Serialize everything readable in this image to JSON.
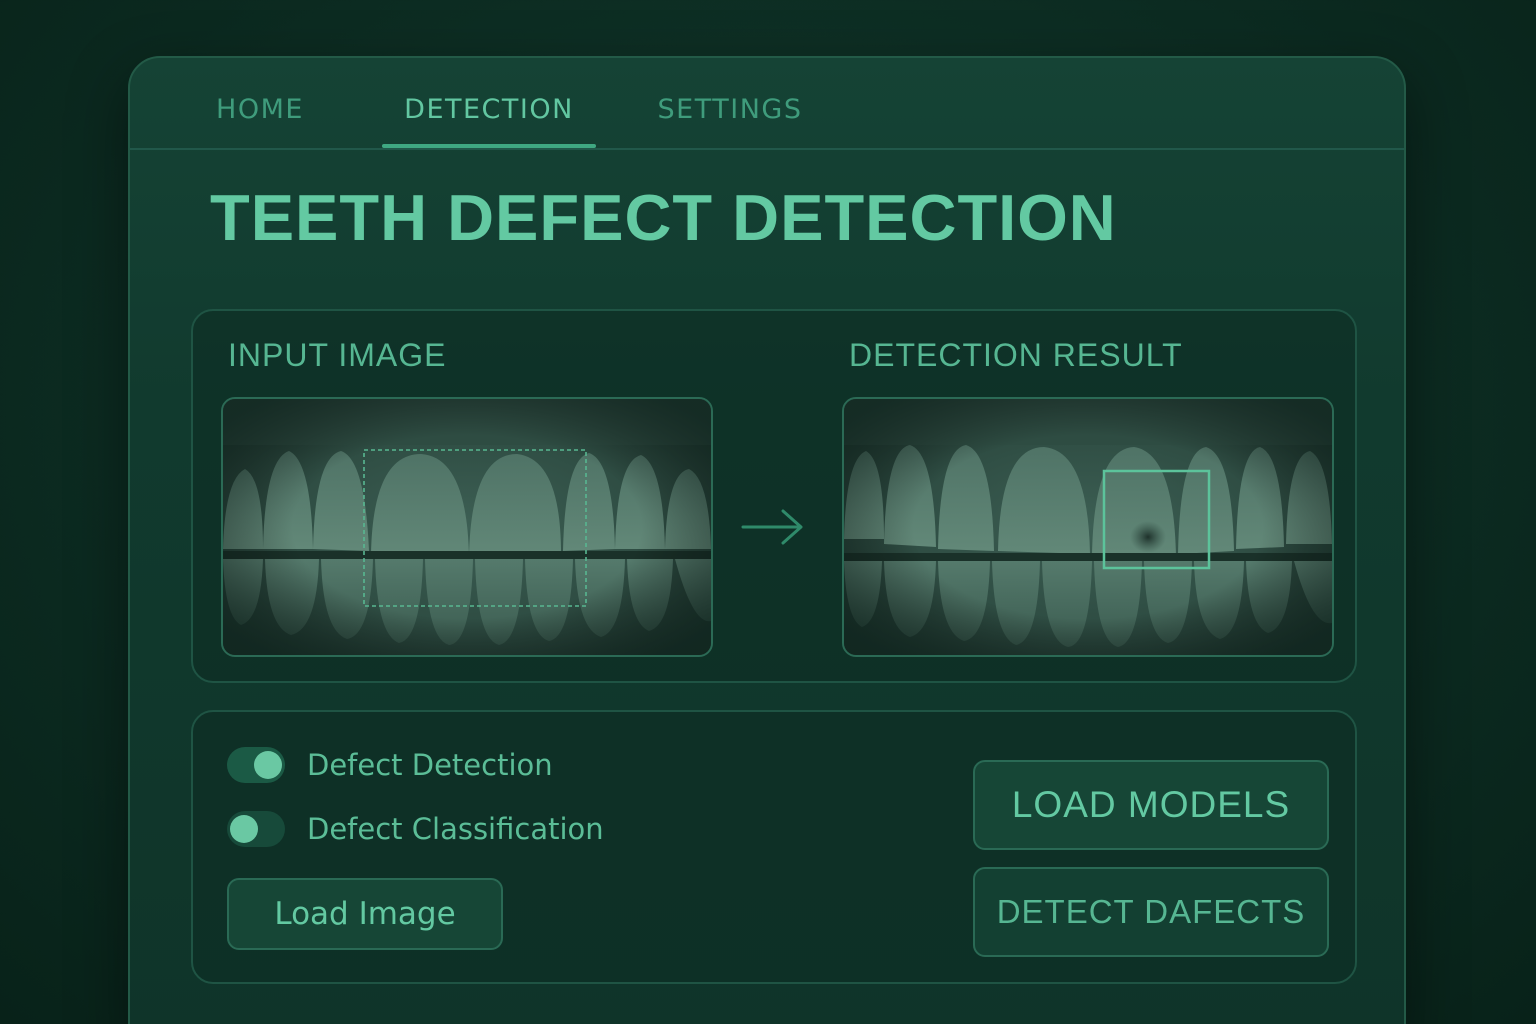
{
  "nav": {
    "tabs": [
      {
        "label": "HOME",
        "active": false
      },
      {
        "label": "DETECTION",
        "active": true
      },
      {
        "label": "SETTINGS",
        "active": false
      }
    ]
  },
  "page": {
    "title": "TEETH DEFECT DETECTION"
  },
  "images": {
    "input_label": "INPUT IMAGE",
    "result_label": "DETECTION RESULT"
  },
  "controls": {
    "toggles": [
      {
        "label": "Defect Detection",
        "on": true
      },
      {
        "label": "Defect Classification",
        "on": false
      }
    ],
    "load_image_label": "Load Image",
    "load_models_label": "LOAD MODELS",
    "detect_label": "DETECT DAFECTS"
  },
  "icons": {
    "arrow": "arrow-right-icon"
  },
  "colors": {
    "accent": "#63c9a2",
    "background": "#0c2b21",
    "panel": "#113a2e",
    "border": "#235a47"
  }
}
